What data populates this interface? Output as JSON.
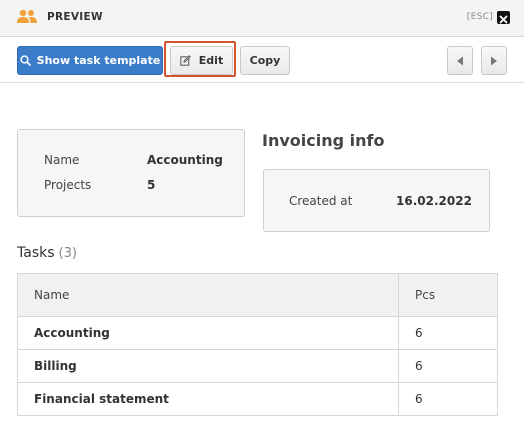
{
  "header": {
    "title": "PREVIEW",
    "esc_label": "[ESC]",
    "accent_color": "#f0a23a"
  },
  "toolbar": {
    "show_template_label": "Show task template",
    "edit_label": "Edit",
    "copy_label": "Copy"
  },
  "details": {
    "name_label": "Name",
    "name_value": "Accounting",
    "projects_label": "Projects",
    "projects_value": "5"
  },
  "invoicing": {
    "title": "Invoicing info",
    "created_label": "Created at",
    "created_value": "16.02.2022"
  },
  "tasks": {
    "title": "Tasks",
    "count": "(3)",
    "columns": [
      "Name",
      "Pcs"
    ],
    "rows": [
      {
        "name": "Accounting",
        "pcs": "6"
      },
      {
        "name": "Billing",
        "pcs": "6"
      },
      {
        "name": "Financial statement",
        "pcs": "6"
      }
    ]
  }
}
